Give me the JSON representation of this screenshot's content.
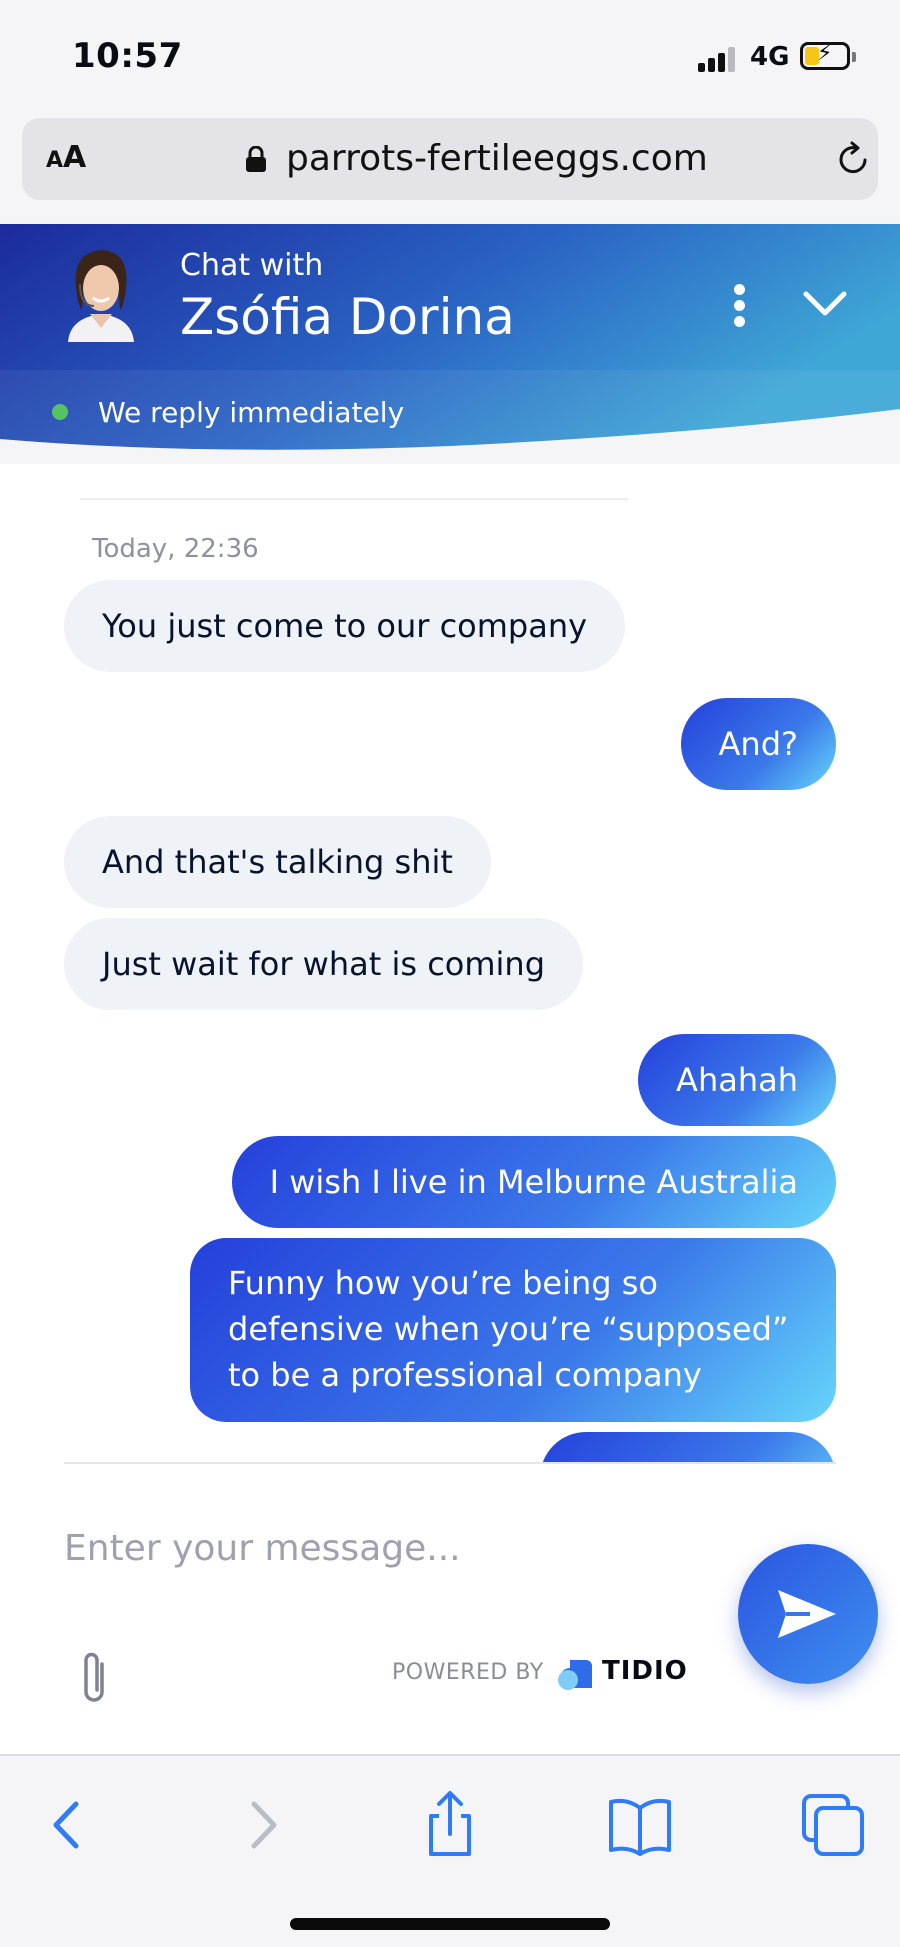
{
  "status_bar": {
    "time": "10:57",
    "network": "4G"
  },
  "browser": {
    "url": "parrots-fertileeggs.com",
    "aa_label_small": "A",
    "aa_label_large": "A"
  },
  "chat_header": {
    "chat_with": "Chat with",
    "agent_name": "Zsófia Dorina",
    "status_text": "We reply immediately",
    "online_color": "#56c262"
  },
  "conversation": {
    "timestamp": "Today, 22:36",
    "messages": [
      {
        "direction": "in",
        "text": "You just come to our company"
      },
      {
        "direction": "out",
        "text": "And?"
      },
      {
        "direction": "in",
        "text": "And that's talking shit"
      },
      {
        "direction": "in",
        "text": "Just wait for what is coming"
      },
      {
        "direction": "out",
        "text": "Ahahah"
      },
      {
        "direction": "out",
        "text": "I wish I live in Melburne Australia"
      },
      {
        "direction": "out",
        "text": "Funny how you’re being so defensive when you’re “supposed” to be a professional company"
      }
    ]
  },
  "composer": {
    "placeholder": "Enter your message...",
    "powered_by": "POWERED BY",
    "brand": "TIDIO"
  },
  "colors": {
    "header_gradient_start": "#1c2a9c",
    "header_gradient_end": "#3fa7d6",
    "outgoing_bubble_start": "#2540db",
    "outgoing_bubble_end": "#66d6fa",
    "incoming_bubble": "#eff2f7",
    "ios_blue": "#2f7cf6"
  },
  "icons": {
    "toolbar": [
      "back-icon",
      "forward-icon",
      "share-icon",
      "bookmarks-icon",
      "tabs-icon"
    ]
  }
}
